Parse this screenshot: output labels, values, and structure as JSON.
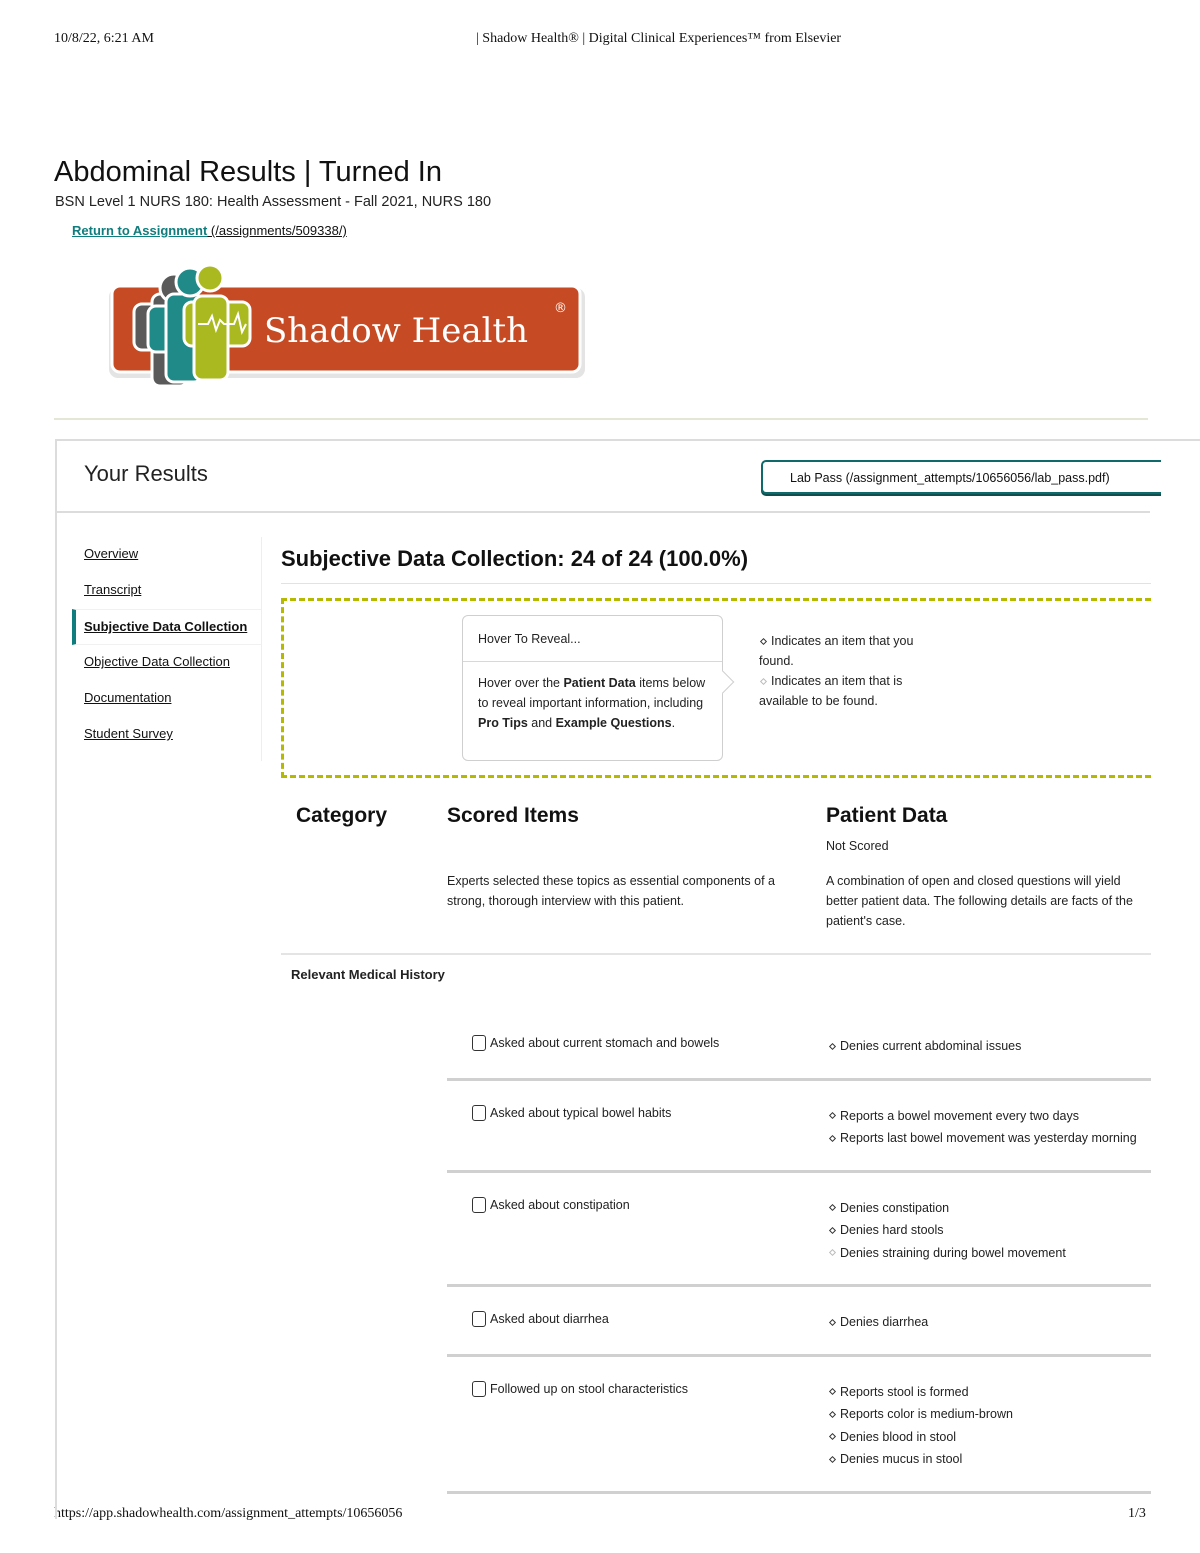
{
  "print": {
    "date": "10/8/22, 6:21 AM",
    "doc_title": "| Shadow Health® | Digital Clinical Experiences™ from Elsevier",
    "url": "https://app.shadowhealth.com/assignment_attempts/10656056",
    "page": "1/3"
  },
  "header": {
    "title": "Abdominal Results | Turned In",
    "subtitle": "BSN Level 1 NURS 180: Health Assessment - Fall 2021, NURS 180",
    "return_link": "Return to Assignment",
    "return_href": " (/assignments/509338/)"
  },
  "logo": {
    "text": "Shadow Health",
    "registered": "®",
    "colors": {
      "bar": "#c64b24",
      "teal": "#1f8a87",
      "lime": "#a9b91f",
      "gray": "#5a5a5a"
    }
  },
  "results": {
    "title": "Your Results",
    "lab_pass": "Lab Pass (/assignment_attempts/10656056/lab_pass.pdf)"
  },
  "nav": {
    "items": [
      {
        "label": "Overview",
        "active": false
      },
      {
        "label": "Transcript",
        "active": false
      },
      {
        "label": "Subjective Data Collection",
        "active": true
      },
      {
        "label": "Objective Data Collection",
        "active": false
      },
      {
        "label": "Documentation",
        "active": false
      },
      {
        "label": "Student Survey",
        "active": false
      }
    ]
  },
  "section": {
    "title": "Subjective Data Collection: 24 of 24 (100.0%)",
    "score": {
      "found": 24,
      "total": 24,
      "percent": 100.0
    }
  },
  "legend": {
    "hover_title": "Hover To Reveal...",
    "hover_body_parts": [
      "Hover over the ",
      "Patient Data",
      " items below to reveal important information, including ",
      "Pro Tips",
      " and ",
      "Example Questions",
      "."
    ],
    "found_text": "Indicates an item that you found.",
    "available_text": "Indicates an item that is available to be found."
  },
  "columns": {
    "category": "Category",
    "scored_items": "Scored Items",
    "patient_data": "Patient Data",
    "not_scored": "Not Scored",
    "scored_desc": "Experts selected these topics as essential components of a strong, thorough interview with this patient.",
    "patient_desc_1": "A combination of open and closed questions will yield",
    "patient_desc_2": "better patient data. The following details are facts of the",
    "patient_desc_3": "patient's case."
  },
  "category": {
    "name": "Relevant Medical History",
    "rows": [
      {
        "scored": "Asked about current stomach and bowels",
        "patient": [
          {
            "text": "Denies current abdominal issues",
            "found": true
          }
        ]
      },
      {
        "scored": "Asked about typical bowel habits",
        "patient": [
          {
            "text": "Reports a bowel movement every two days",
            "found": true
          },
          {
            "text": "Reports last bowel movement was yesterday morning",
            "found": true
          }
        ]
      },
      {
        "scored": "Asked about constipation",
        "patient": [
          {
            "text": "Denies constipation",
            "found": true
          },
          {
            "text": "Denies hard stools",
            "found": true
          },
          {
            "text": "Denies straining during bowel movement",
            "found": false
          }
        ]
      },
      {
        "scored": "Asked about diarrhea",
        "patient": [
          {
            "text": "Denies diarrhea",
            "found": true
          }
        ]
      },
      {
        "scored": "Followed up on stool characteristics",
        "patient": [
          {
            "text": "Reports stool is formed",
            "found": true
          },
          {
            "text": "Reports color is medium-brown",
            "found": true
          },
          {
            "text": "Denies blood in stool",
            "found": true
          },
          {
            "text": "Denies mucus in stool",
            "found": true
          }
        ]
      }
    ]
  }
}
